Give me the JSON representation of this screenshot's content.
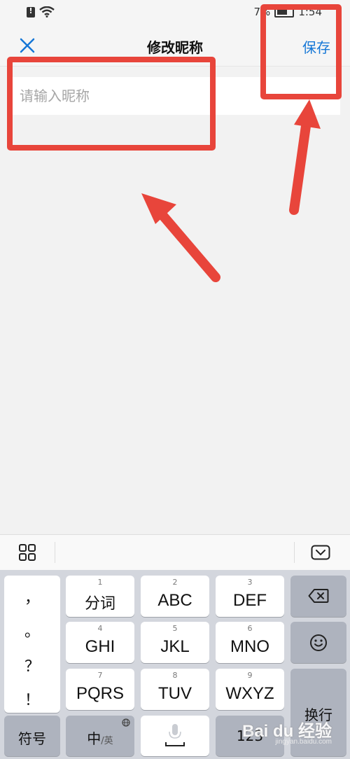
{
  "status": {
    "battery_percent": "7%",
    "time": "1:54"
  },
  "header": {
    "title": "修改昵称",
    "save_label": "保存"
  },
  "form": {
    "nickname_placeholder": "请输入昵称",
    "nickname_value": ""
  },
  "keyboard": {
    "punctuation": [
      "，",
      "。",
      "？",
      "！"
    ],
    "rows": [
      [
        {
          "num": "1",
          "label": "分词"
        },
        {
          "num": "2",
          "label": "ABC"
        },
        {
          "num": "3",
          "label": "DEF"
        }
      ],
      [
        {
          "num": "4",
          "label": "GHI"
        },
        {
          "num": "5",
          "label": "JKL"
        },
        {
          "num": "6",
          "label": "MNO"
        }
      ],
      [
        {
          "num": "7",
          "label": "PQRS"
        },
        {
          "num": "8",
          "label": "TUV"
        },
        {
          "num": "9",
          "label": "WXYZ"
        }
      ]
    ],
    "bottom": {
      "symbols": "符号",
      "lang_main": "中",
      "lang_sub": "/英",
      "numbers": "123"
    },
    "enter_label": "换行"
  },
  "watermark": {
    "brand": "Bai du 经验",
    "url": "jingyan.baidu.com"
  },
  "colors": {
    "accent": "#1677d6",
    "annotation": "#e8453b"
  }
}
